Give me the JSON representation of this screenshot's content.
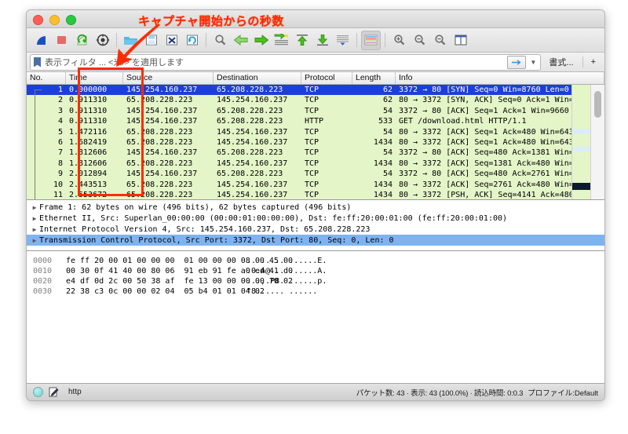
{
  "window": {
    "traffic_lights": [
      "close",
      "minimize",
      "zoom"
    ]
  },
  "annotation": {
    "label": "キャプチャ開始からの秒数",
    "color": "#ff2b00"
  },
  "toolbar": {
    "buttons": [
      {
        "name": "start-capture",
        "title": "開始"
      },
      {
        "name": "stop-capture",
        "title": "停止"
      },
      {
        "name": "restart-capture",
        "title": "再開"
      },
      {
        "name": "capture-options",
        "title": "キャプチャオプション"
      },
      {
        "name": "open-file",
        "title": "開く"
      },
      {
        "name": "save-file",
        "title": "保存"
      },
      {
        "name": "close-file",
        "title": "閉じる"
      },
      {
        "name": "reload-file",
        "title": "再読込"
      },
      {
        "name": "find-packet",
        "title": "検索"
      },
      {
        "name": "go-back",
        "title": "戻る"
      },
      {
        "name": "go-forward",
        "title": "進む"
      },
      {
        "name": "go-to-packet",
        "title": "指定パケットへ"
      },
      {
        "name": "go-to-first",
        "title": "先頭へ"
      },
      {
        "name": "go-to-last",
        "title": "最後へ"
      },
      {
        "name": "auto-scroll",
        "title": "自動スクロール"
      },
      {
        "name": "colorize-packets",
        "title": "色分け"
      },
      {
        "name": "zoom-in",
        "title": "拡大"
      },
      {
        "name": "zoom-out",
        "title": "縮小"
      },
      {
        "name": "zoom-reset",
        "title": "標準サイズ"
      },
      {
        "name": "resize-columns",
        "title": "列幅の調整"
      }
    ]
  },
  "filter_bar": {
    "placeholder": "表示フィルタ ... <米/> を適用します",
    "value": "",
    "apply_label": "→",
    "expression_label": "書式...",
    "add_label": "+"
  },
  "packet_list": {
    "columns": [
      {
        "key": "no",
        "label": "No."
      },
      {
        "key": "time",
        "label": "Time"
      },
      {
        "key": "source",
        "label": "Source"
      },
      {
        "key": "destination",
        "label": "Destination"
      },
      {
        "key": "protocol",
        "label": "Protocol"
      },
      {
        "key": "length",
        "label": "Length"
      },
      {
        "key": "info",
        "label": "Info"
      }
    ],
    "selected_index": 0,
    "rows": [
      {
        "no": "1",
        "time": "0.000000",
        "source": "145.254.160.237",
        "destination": "65.208.228.223",
        "protocol": "TCP",
        "length": "62",
        "info": "3372 → 80 [SYN] Seq=0 Win=8760 Len=0 M"
      },
      {
        "no": "2",
        "time": "0.911310",
        "source": "65.208.228.223",
        "destination": "145.254.160.237",
        "protocol": "TCP",
        "length": "62",
        "info": "80 → 3372 [SYN, ACK] Seq=0 Ack=1 Win="
      },
      {
        "no": "3",
        "time": "0.911310",
        "source": "145.254.160.237",
        "destination": "65.208.228.223",
        "protocol": "TCP",
        "length": "54",
        "info": "3372 → 80 [ACK] Seq=1 Ack=1 Win=9660 "
      },
      {
        "no": "4",
        "time": "0.911310",
        "source": "145.254.160.237",
        "destination": "65.208.228.223",
        "protocol": "HTTP",
        "length": "533",
        "info": "GET /download.html HTTP/1.1"
      },
      {
        "no": "5",
        "time": "1.472116",
        "source": "65.208.228.223",
        "destination": "145.254.160.237",
        "protocol": "TCP",
        "length": "54",
        "info": "80 → 3372 [ACK] Seq=1 Ack=480 Win=6432"
      },
      {
        "no": "6",
        "time": "1.682419",
        "source": "65.208.228.223",
        "destination": "145.254.160.237",
        "protocol": "TCP",
        "length": "1434",
        "info": "80 → 3372 [ACK] Seq=1 Ack=480 Win=6432"
      },
      {
        "no": "7",
        "time": "1.812606",
        "source": "145.254.160.237",
        "destination": "65.208.228.223",
        "protocol": "TCP",
        "length": "54",
        "info": "3372 → 80 [ACK] Seq=480 Ack=1381 Win="
      },
      {
        "no": "8",
        "time": "1.812606",
        "source": "65.208.228.223",
        "destination": "145.254.160.237",
        "protocol": "TCP",
        "length": "1434",
        "info": "80 → 3372 [ACK] Seq=1381 Ack=480 Win="
      },
      {
        "no": "9",
        "time": "2.012894",
        "source": "145.254.160.237",
        "destination": "65.208.228.223",
        "protocol": "TCP",
        "length": "54",
        "info": "3372 → 80 [ACK] Seq=480 Ack=2761 Win="
      },
      {
        "no": "10",
        "time": "2.443513",
        "source": "65.208.228.223",
        "destination": "145.254.160.237",
        "protocol": "TCP",
        "length": "1434",
        "info": "80 → 3372 [ACK] Seq=2761 Ack=480 Win="
      },
      {
        "no": "11",
        "time": "2.553672",
        "source": "65.208.228.223",
        "destination": "145.254.160.237",
        "protocol": "TCP",
        "length": "1434",
        "info": "80 → 3372 [PSH, ACK] Seq=4141 Ack=480"
      }
    ]
  },
  "detail_pane": {
    "selected_index": 3,
    "lines": [
      "Frame 1: 62 bytes on wire (496 bits), 62 bytes captured (496 bits)",
      "Ethernet II, Src: Superlan_00:00:00 (00:00:01:00:00:00), Dst: fe:ff:20:00:01:00 (fe:ff:20:00:01:00)",
      "Internet Protocol Version 4, Src: 145.254.160.237, Dst: 65.208.228.223",
      "Transmission Control Protocol, Src Port: 3372, Dst Port: 80, Seq: 0, Len: 0"
    ]
  },
  "hex_pane": {
    "lines": [
      {
        "offset": "0000",
        "bytes": "fe ff 20 00 01 00 00 00  01 00 00 00 08 00 45 00",
        "ascii": ".. ..... ......E."
      },
      {
        "offset": "0010",
        "bytes": "00 30 0f 41 40 00 80 06  91 eb 91 fe a0 ed 41 d0",
        "ascii": ".0.A@... ......A."
      },
      {
        "offset": "0020",
        "bytes": "e4 df 0d 2c 00 50 38 af  fe 13 00 00 00 00 70 02",
        "ascii": "...,.P8. ......p."
      },
      {
        "offset": "0030",
        "bytes": "22 38 c3 0c 00 00 02 04  05 b4 01 01 04 02",
        "ascii": "\"8...... ......"
      }
    ]
  },
  "status_bar": {
    "field_label": "http",
    "counts": "パケット数: 43 · 表示: 43 (100.0%) · 読込時間: 0:0.3",
    "profile": "プロファイル:Default"
  }
}
